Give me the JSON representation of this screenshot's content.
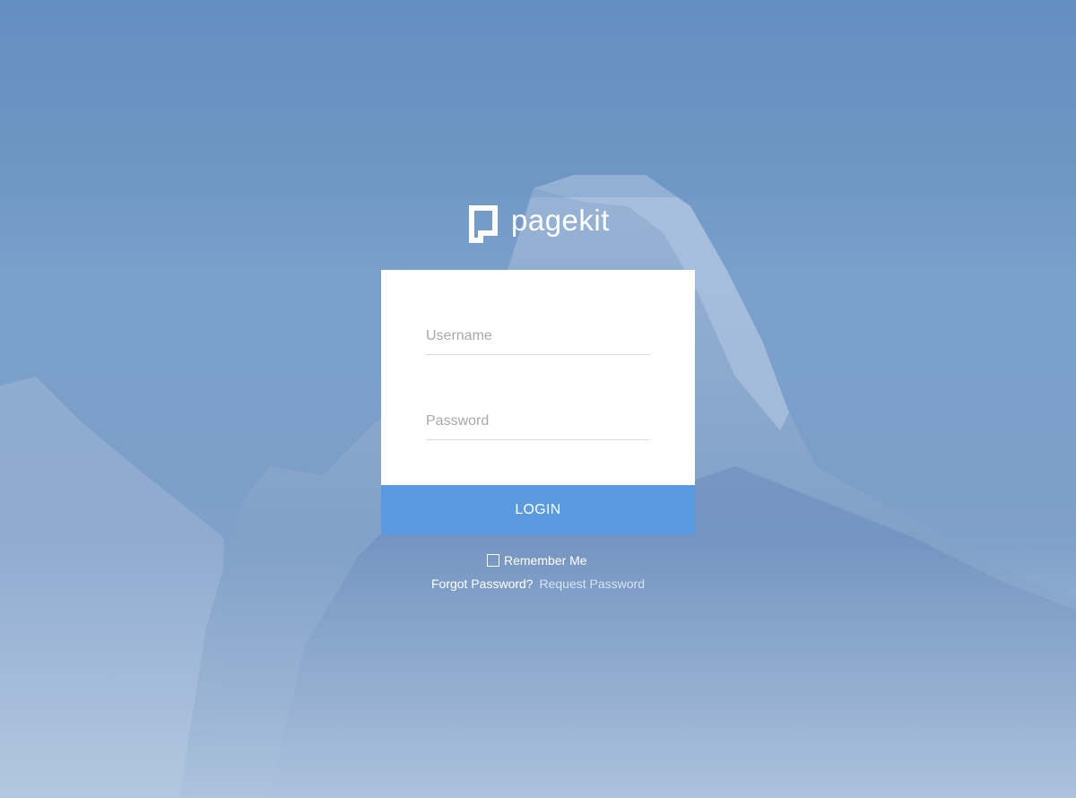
{
  "brand": {
    "name": "pagekit",
    "logo_icon": "pagekit-logo-icon"
  },
  "form": {
    "username_placeholder": "Username",
    "password_placeholder": "Password",
    "login_label": "LOGIN",
    "remember_label": "Remember Me",
    "remember_checked": false,
    "forgot_label": "Forgot Password?",
    "request_link": "Request Password"
  },
  "colors": {
    "button": "#5a9ae0",
    "background": "#7aa0cb",
    "card": "#ffffff"
  }
}
